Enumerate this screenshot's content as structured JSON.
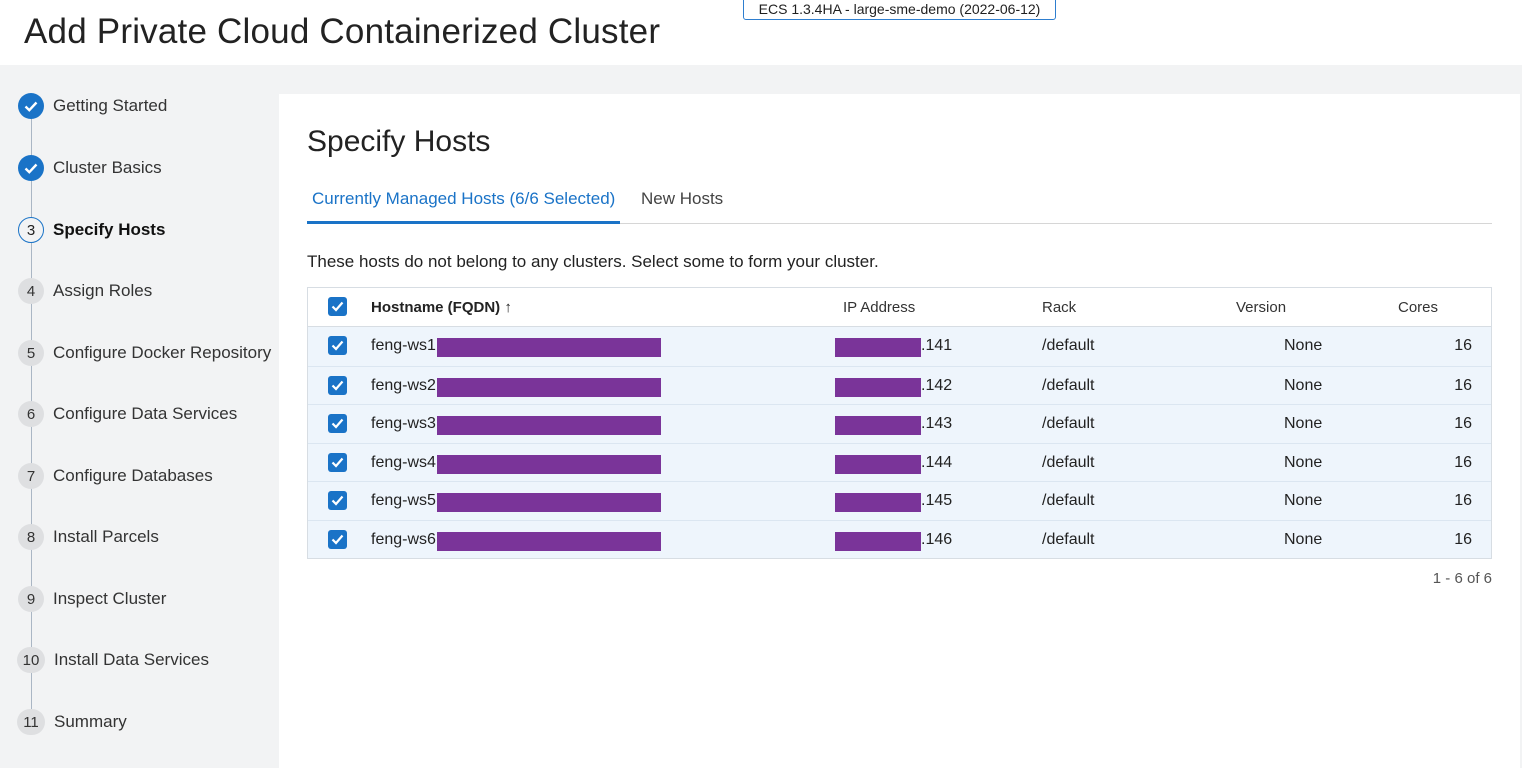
{
  "version_badge": "ECS 1.3.4HA - large-sme-demo (2022-06-12)",
  "page_title": "Add Private Cloud Containerized Cluster",
  "steps": [
    {
      "marker": "",
      "label": "Getting Started",
      "state": "done"
    },
    {
      "marker": "",
      "label": "Cluster Basics",
      "state": "done"
    },
    {
      "marker": "3",
      "label": "Specify Hosts",
      "state": "current"
    },
    {
      "marker": "4",
      "label": "Assign Roles",
      "state": "pending"
    },
    {
      "marker": "5",
      "label": "Configure Docker Repository",
      "state": "pending"
    },
    {
      "marker": "6",
      "label": "Configure Data Services",
      "state": "pending"
    },
    {
      "marker": "7",
      "label": "Configure Databases",
      "state": "pending"
    },
    {
      "marker": "8",
      "label": "Install Parcels",
      "state": "pending"
    },
    {
      "marker": "9",
      "label": "Inspect Cluster",
      "state": "pending"
    },
    {
      "marker": "10",
      "label": "Install Data Services",
      "state": "pending"
    },
    {
      "marker": "11",
      "label": "Summary",
      "state": "pending"
    }
  ],
  "main": {
    "title": "Specify Hosts",
    "tabs": [
      {
        "label": "Currently Managed Hosts (6/6 Selected)",
        "active": true
      },
      {
        "label": "New Hosts",
        "active": false
      }
    ],
    "description": "These hosts do not belong to any clusters. Select some to form your cluster.",
    "table": {
      "headers": {
        "hostname": "Hostname (FQDN) ↑",
        "ip": "IP Address",
        "rack": "Rack",
        "version": "Version",
        "cores": "Cores"
      },
      "select_all_checked": true,
      "rows": [
        {
          "checked": true,
          "hostname": "feng-ws1.",
          "ip": ".141",
          "rack": "/default",
          "version": "None",
          "cores": "16"
        },
        {
          "checked": true,
          "hostname": "feng-ws2.",
          "ip": ".142",
          "rack": "/default",
          "version": "None",
          "cores": "16"
        },
        {
          "checked": true,
          "hostname": "feng-ws3.",
          "ip": ".143",
          "rack": "/default",
          "version": "None",
          "cores": "16"
        },
        {
          "checked": true,
          "hostname": "feng-ws4.",
          "ip": ".144",
          "rack": "/default",
          "version": "None",
          "cores": "16"
        },
        {
          "checked": true,
          "hostname": "feng-ws5.",
          "ip": ".145",
          "rack": "/default",
          "version": "None",
          "cores": "16"
        },
        {
          "checked": true,
          "hostname": "feng-ws6.",
          "ip": ".146",
          "rack": "/default",
          "version": "None",
          "cores": "16"
        }
      ]
    },
    "pagination": "1 - 6 of 6"
  },
  "colors": {
    "accent": "#1a73c7",
    "redaction": "#7a3499",
    "row_selected": "#eef5fc",
    "page_bg": "#f2f3f4"
  }
}
